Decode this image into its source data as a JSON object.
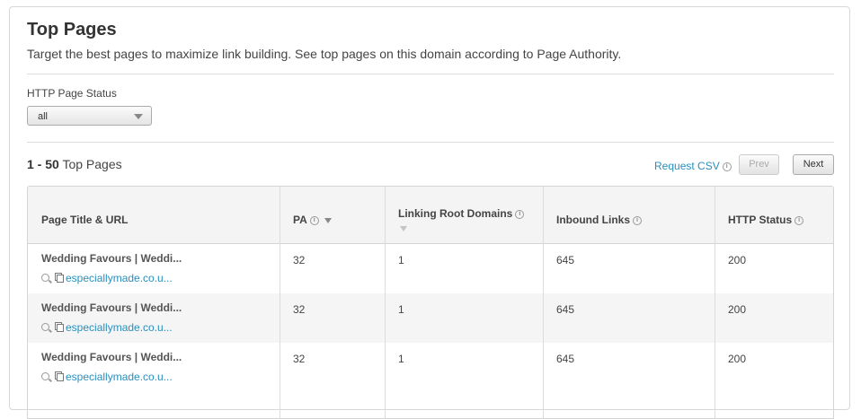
{
  "header": {
    "title": "Top Pages",
    "subtitle": "Target the best pages to maximize link building. See top pages on this domain according to Page Authority."
  },
  "filter": {
    "label": "HTTP Page Status",
    "selected": "all"
  },
  "results": {
    "range": "1 - 50",
    "range_suffix": "Top Pages",
    "csv_label": "Request CSV",
    "prev_label": "Prev",
    "next_label": "Next"
  },
  "table": {
    "columns": {
      "page": "Page Title & URL",
      "pa": "PA",
      "lrd": "Linking Root Domains",
      "inbound": "Inbound Links",
      "status": "HTTP Status"
    },
    "rows": [
      {
        "title": "Wedding Favours | Weddi...",
        "url": "especiallymade.co.u...",
        "pa": "32",
        "lrd": "1",
        "inbound": "645",
        "status": "200"
      },
      {
        "title": "Wedding Favours | Weddi...",
        "url": "especiallymade.co.u...",
        "pa": "32",
        "lrd": "1",
        "inbound": "645",
        "status": "200"
      },
      {
        "title": "Wedding Favours | Weddi...",
        "url": "especiallymade.co.u...",
        "pa": "32",
        "lrd": "1",
        "inbound": "645",
        "status": "200"
      }
    ]
  },
  "icons": {
    "info": "info-icon",
    "sort": "sort-caret-icon",
    "search": "search-icon",
    "copy": "copy-icon"
  },
  "colors": {
    "link": "#2a8fbd",
    "header_bg": "#f4f4f4",
    "alt_row_bg": "#f5f5f5"
  }
}
